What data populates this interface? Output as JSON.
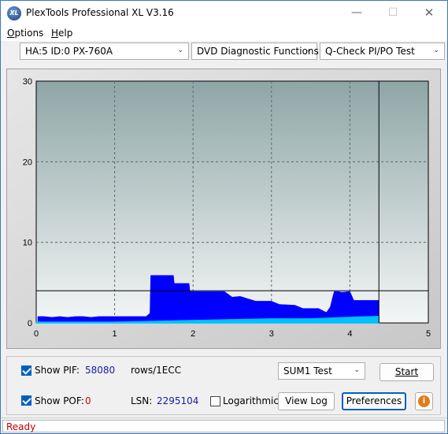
{
  "window": {
    "title": "PlexTools Professional XL V3.16",
    "icon_text": "XL",
    "min_glyph": "—",
    "max_glyph": "☐",
    "close_glyph": "✕"
  },
  "menu": {
    "items": [
      {
        "label": "Options",
        "underline": "O",
        "rest": "ptions"
      },
      {
        "label": "Help",
        "underline": "H",
        "rest": "elp"
      }
    ]
  },
  "toolbar": {
    "drive_select": "HA:5 ID:0  PX-760A",
    "function_select": "DVD Diagnostic Functions",
    "test_select": "Q-Check PI/PO Test"
  },
  "chart_data": {
    "type": "area",
    "x_ticks": [
      "0",
      "1",
      "2",
      "3",
      "4",
      "5"
    ],
    "y_ticks": [
      "0",
      "10",
      "20",
      "30"
    ],
    "xlim": [
      0,
      5
    ],
    "ylim": [
      0,
      30
    ],
    "grid": true,
    "end_marker_x": 4.37,
    "threshold_y": 4,
    "series": [
      {
        "color": "#0000ff",
        "points": [
          [
            0.02,
            0.8
          ],
          [
            0.1,
            0.8
          ],
          [
            0.2,
            0.7
          ],
          [
            0.3,
            0.8
          ],
          [
            0.4,
            0.7
          ],
          [
            0.5,
            0.8
          ],
          [
            0.6,
            0.8
          ],
          [
            0.7,
            0.7
          ],
          [
            0.8,
            0.8
          ],
          [
            0.9,
            0.8
          ],
          [
            1.0,
            0.8
          ],
          [
            1.1,
            0.8
          ],
          [
            1.2,
            0.8
          ],
          [
            1.3,
            0.8
          ],
          [
            1.4,
            0.8
          ],
          [
            1.45,
            1.2
          ],
          [
            1.46,
            5.9
          ],
          [
            1.6,
            5.9
          ],
          [
            1.75,
            5.9
          ],
          [
            1.76,
            4.9
          ],
          [
            1.95,
            4.9
          ],
          [
            1.96,
            3.9
          ],
          [
            2.2,
            3.9
          ],
          [
            2.4,
            3.9
          ],
          [
            2.5,
            3.2
          ],
          [
            2.6,
            3.3
          ],
          [
            2.8,
            2.7
          ],
          [
            3.0,
            2.7
          ],
          [
            3.1,
            2.3
          ],
          [
            3.3,
            2.2
          ],
          [
            3.4,
            1.8
          ],
          [
            3.6,
            1.8
          ],
          [
            3.7,
            1.3
          ],
          [
            3.75,
            2.0
          ],
          [
            3.78,
            3.2
          ],
          [
            3.8,
            3.9
          ],
          [
            3.85,
            3.9
          ],
          [
            3.9,
            3.8
          ],
          [
            4.0,
            3.9
          ],
          [
            4.05,
            2.8
          ],
          [
            4.2,
            2.8
          ],
          [
            4.37,
            2.8
          ]
        ]
      },
      {
        "color": "#00c0ff",
        "points": [
          [
            0,
            0.1
          ],
          [
            1.0,
            0.1
          ],
          [
            1.5,
            0.2
          ],
          [
            2.0,
            0.3
          ],
          [
            2.5,
            0.4
          ],
          [
            3.0,
            0.5
          ],
          [
            3.5,
            0.5
          ],
          [
            4.0,
            0.7
          ],
          [
            4.37,
            0.8
          ]
        ]
      }
    ]
  },
  "controls": {
    "show_pif_label": "Show PIF:",
    "show_pif_checked": true,
    "pif_value": "58080",
    "pif_unit": "rows/1ECC",
    "show_pof_label": "Show POF:",
    "show_pof_checked": true,
    "pof_value": "0",
    "lsn_label": "LSN:",
    "lsn_value": "2295104",
    "logarithmic_label": "Logarithmic",
    "logarithmic_checked": false,
    "sum_select": "SUM1 Test",
    "start_button": "Start",
    "view_log_button": "View Log",
    "preferences_button": "Preferences",
    "info_glyph": "i"
  },
  "status": {
    "text": "Ready"
  },
  "colors": {
    "pif_value": "#1a1aa6",
    "pof_value": "#d00000",
    "status_text": "#c00000",
    "plot_fill": "#0000ff"
  }
}
